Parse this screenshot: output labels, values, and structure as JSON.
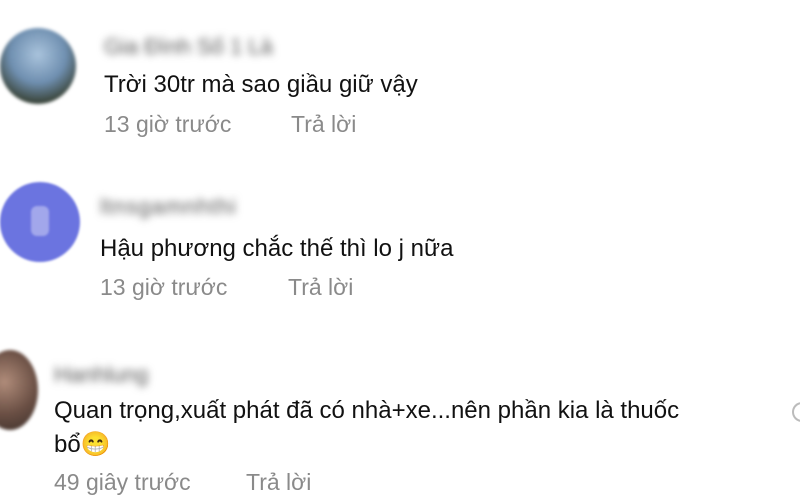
{
  "comments": [
    {
      "text": "Trời 30tr mà sao giầu giữ vậy",
      "time": "13 giờ trước",
      "reply": "Trả lời"
    },
    {
      "text": "Hậu phương chắc thế thì lo j nữa",
      "time": "13 giờ trước",
      "reply": "Trả lời"
    },
    {
      "text_line1": "Quan trọng,xuất phát đã có nhà+xe...nên phần kia là thuốc",
      "text_line2": "bổ😁",
      "time": "49 giây trước",
      "reply": "Trả lời"
    }
  ],
  "colors": {
    "text": "#111111",
    "meta": "#8a8a8a",
    "avatar2": "#6b74e0"
  }
}
